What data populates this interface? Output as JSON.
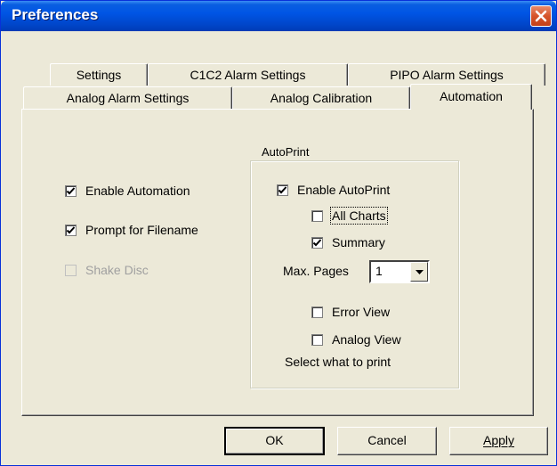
{
  "window": {
    "title": "Preferences"
  },
  "tabs": {
    "row_back": [
      "Settings",
      "C1C2 Alarm Settings",
      "PIPO Alarm Settings"
    ],
    "row_front": [
      "Analog Alarm Settings",
      "Analog Calibration",
      "Automation"
    ],
    "active": "Automation"
  },
  "automation": {
    "enable_automation": {
      "label": "Enable Automation",
      "checked": true
    },
    "prompt_filename": {
      "label": "Prompt for Filename",
      "checked": true
    },
    "shake_disc": {
      "label": "Shake Disc",
      "checked": false,
      "disabled": true
    }
  },
  "autoprint": {
    "group_title": "AutoPrint",
    "enable_autoprint": {
      "label": "Enable AutoPrint",
      "checked": true
    },
    "all_charts": {
      "label": "All Charts",
      "checked": false
    },
    "summary": {
      "label": "Summary",
      "checked": true
    },
    "max_pages_label": "Max. Pages",
    "max_pages_value": "1",
    "error_view": {
      "label": "Error View",
      "checked": false
    },
    "analog_view": {
      "label": "Analog View",
      "checked": false
    },
    "hint": "Select what to print"
  },
  "buttons": {
    "ok": "OK",
    "cancel": "Cancel",
    "apply": "Apply"
  },
  "colors": {
    "titlebar": "#0055e5",
    "face": "#ece9d8",
    "close": "#d6542a"
  }
}
